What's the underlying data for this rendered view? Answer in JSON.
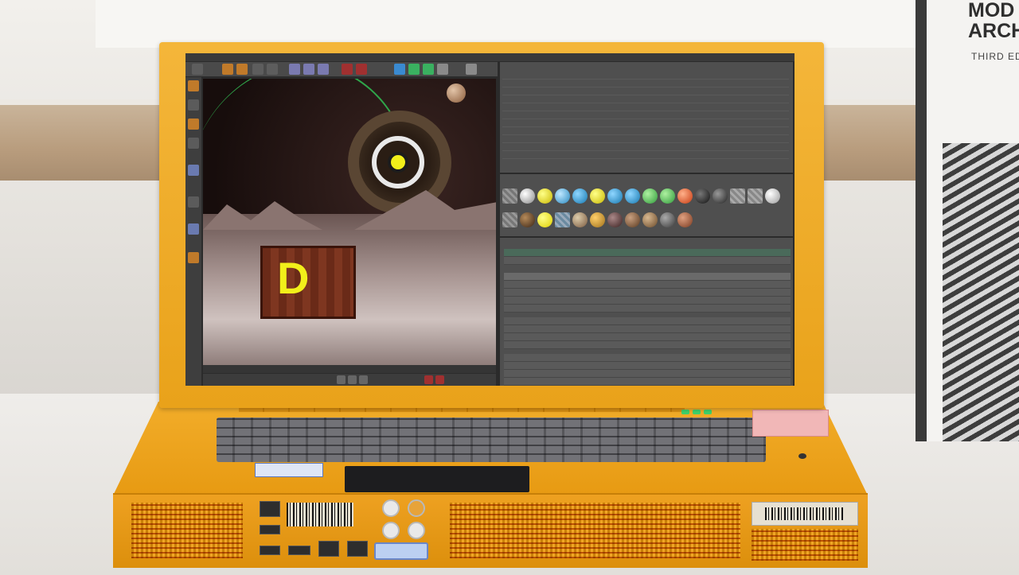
{
  "scene": {
    "book": {
      "title_line1": "MOD",
      "title_line2": "ARCH",
      "subtitle": "THIRD ED"
    },
    "laptop": {
      "color": "#f0a82a",
      "screen_app": {
        "viewport_letter": "D",
        "accent": "#f2ef1a"
      }
    }
  }
}
